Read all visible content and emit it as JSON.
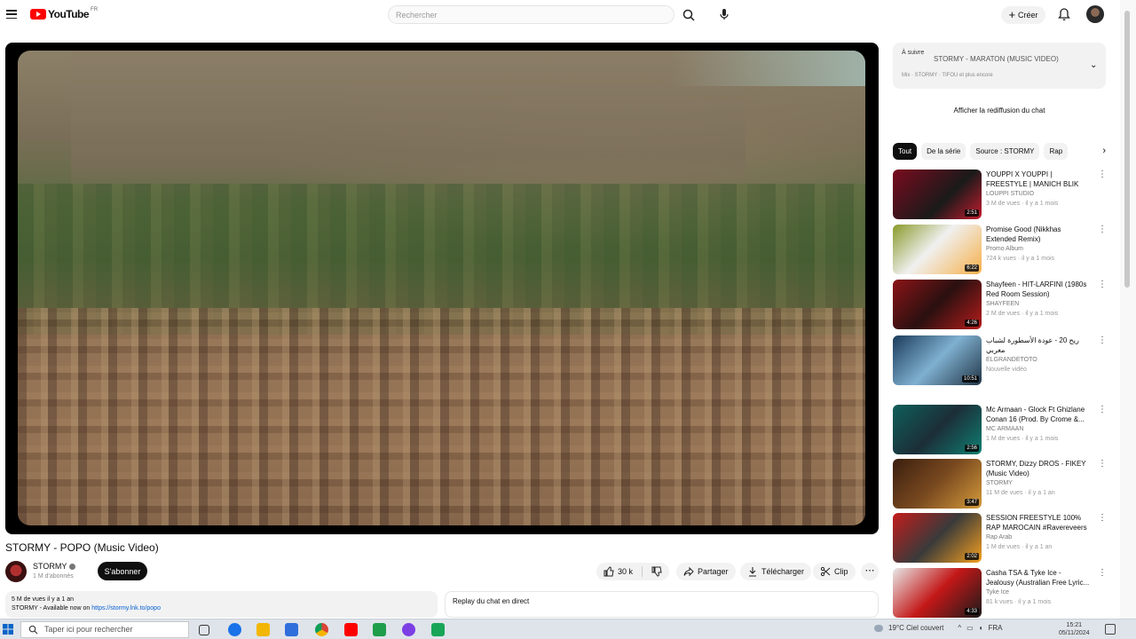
{
  "header": {
    "logo_text": "YouTube",
    "logo_country": "FR",
    "search_placeholder": "Rechercher",
    "create_label": "Créer"
  },
  "video": {
    "title": "STORMY - POPO (Music Video)",
    "channel_name": "STORMY",
    "subscribers": "1 M d'abonnés",
    "subscribe_label": "S'abonner",
    "like_count": "30 k",
    "share_label": "Partager",
    "download_label": "Télécharger",
    "clip_label": "Clip",
    "description_line1": "5 M de vues  il y a 1 an",
    "description_line2_prefix": "STORMY - Available now on ",
    "description_link": "https://stormy.lnk.to/popo",
    "chat_replay_label": "Replay du chat en direct"
  },
  "playlist": {
    "left_label": "À suivre",
    "title": "STORMY - MARATON (MUSIC VIDEO)",
    "subtitle": "Mix · STORMY · TIFOU et plus encore"
  },
  "chat_replay_button": "Afficher la rediffusion du chat",
  "chips": [
    "Tout",
    "De la série",
    "Source : STORMY",
    "Rap"
  ],
  "recommendations": [
    {
      "title": "YOUPPI X YOUPPI | FREESTYLE | MANICH BLIK",
      "channel": "LOUPPI STUDIO",
      "meta": "3 M de vues · il y a 1 mois",
      "duration": "2:51"
    },
    {
      "title": "Promise Good (Nikkhas Extended Remix)",
      "channel": "Promo Album",
      "meta": "724 k vues · il y a 1 mois",
      "duration": "6:22"
    },
    {
      "title": "Shayfeen - HIT-LARFINI (1980s Red Room Session)",
      "channel": "SHAYFEEN",
      "meta": "2 M de vues · il y a 1 mois",
      "duration": "4:26"
    },
    {
      "title": "ريح 20 - عودة الأسطورة لشباب مغربي",
      "channel": "ELGRANDETOTO",
      "meta": "Nouvelle vidéo",
      "duration": "10:51"
    },
    {
      "title": "Mc Armaan - Glock Ft Ghizlane Conan 16 (Prod. By Crome &...",
      "channel": "MC ARMAAN",
      "meta": "1 M de vues · il y a 1 mois",
      "duration": "2:56"
    },
    {
      "title": "STORMY, Dizzy DROS - FIKEY (Music Video)",
      "channel": "STORMY",
      "meta": "11 M de vues · il y a 1 an",
      "duration": "3:47"
    },
    {
      "title": "SESSION FREESTYLE 100% RAP MAROCAIN #Ravereveers",
      "channel": "Rap Arab",
      "meta": "1 M de vues · il y a 1 an",
      "duration": "2:02"
    },
    {
      "title": "Casha TSA & Tyke Ice - Jealousy (Australian Free Lyric...",
      "channel": "Tyke Ice",
      "meta": "81 k vues · il y a 1 mois",
      "duration": "4:33"
    }
  ],
  "taskbar": {
    "search_placeholder": "Taper ici pour rechercher",
    "weather": "19°C  Ciel couvert",
    "language": "FRA",
    "time": "15:21",
    "date": "05/11/2024"
  }
}
